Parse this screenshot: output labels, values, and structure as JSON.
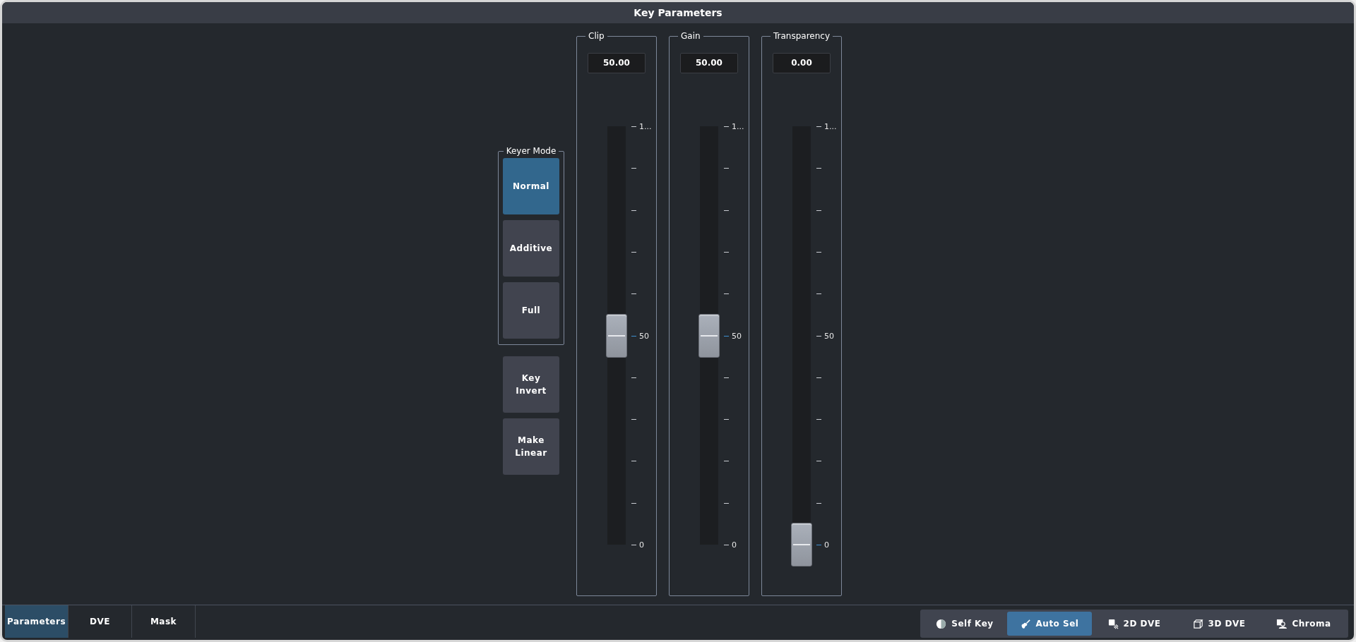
{
  "window": {
    "title": "Key Parameters"
  },
  "keyer_mode": {
    "label": "Keyer Mode",
    "options": [
      {
        "label": "Normal",
        "selected": true
      },
      {
        "label": "Additive",
        "selected": false
      },
      {
        "label": "Full",
        "selected": false
      }
    ]
  },
  "action_buttons": [
    {
      "label": "Key Invert"
    },
    {
      "label": "Make Linear"
    }
  ],
  "faders": [
    {
      "label": "Clip",
      "value": "50.00",
      "level": 0.5,
      "scale": [
        "1...",
        "50",
        "0"
      ]
    },
    {
      "label": "Gain",
      "value": "50.00",
      "level": 0.5,
      "scale": [
        "1...",
        "50",
        "0"
      ]
    },
    {
      "label": "Transparency",
      "value": "0.00",
      "level": 0,
      "scale": [
        "1...",
        "50",
        "0"
      ]
    }
  ],
  "tabs": [
    {
      "label": "Parameters",
      "selected": true
    },
    {
      "label": "DVE",
      "selected": false
    },
    {
      "label": "Mask",
      "selected": false
    }
  ],
  "key_types": [
    {
      "kind": "self_key",
      "label": "Self Key",
      "selected": false
    },
    {
      "kind": "auto_sel",
      "label": "Auto Sel",
      "selected": true
    },
    {
      "kind": "dve_2d",
      "label": "2D DVE",
      "selected": false
    },
    {
      "kind": "dve_3d",
      "label": "3D DVE",
      "selected": false
    },
    {
      "kind": "chroma",
      "label": "Chroma",
      "selected": false
    }
  ]
}
